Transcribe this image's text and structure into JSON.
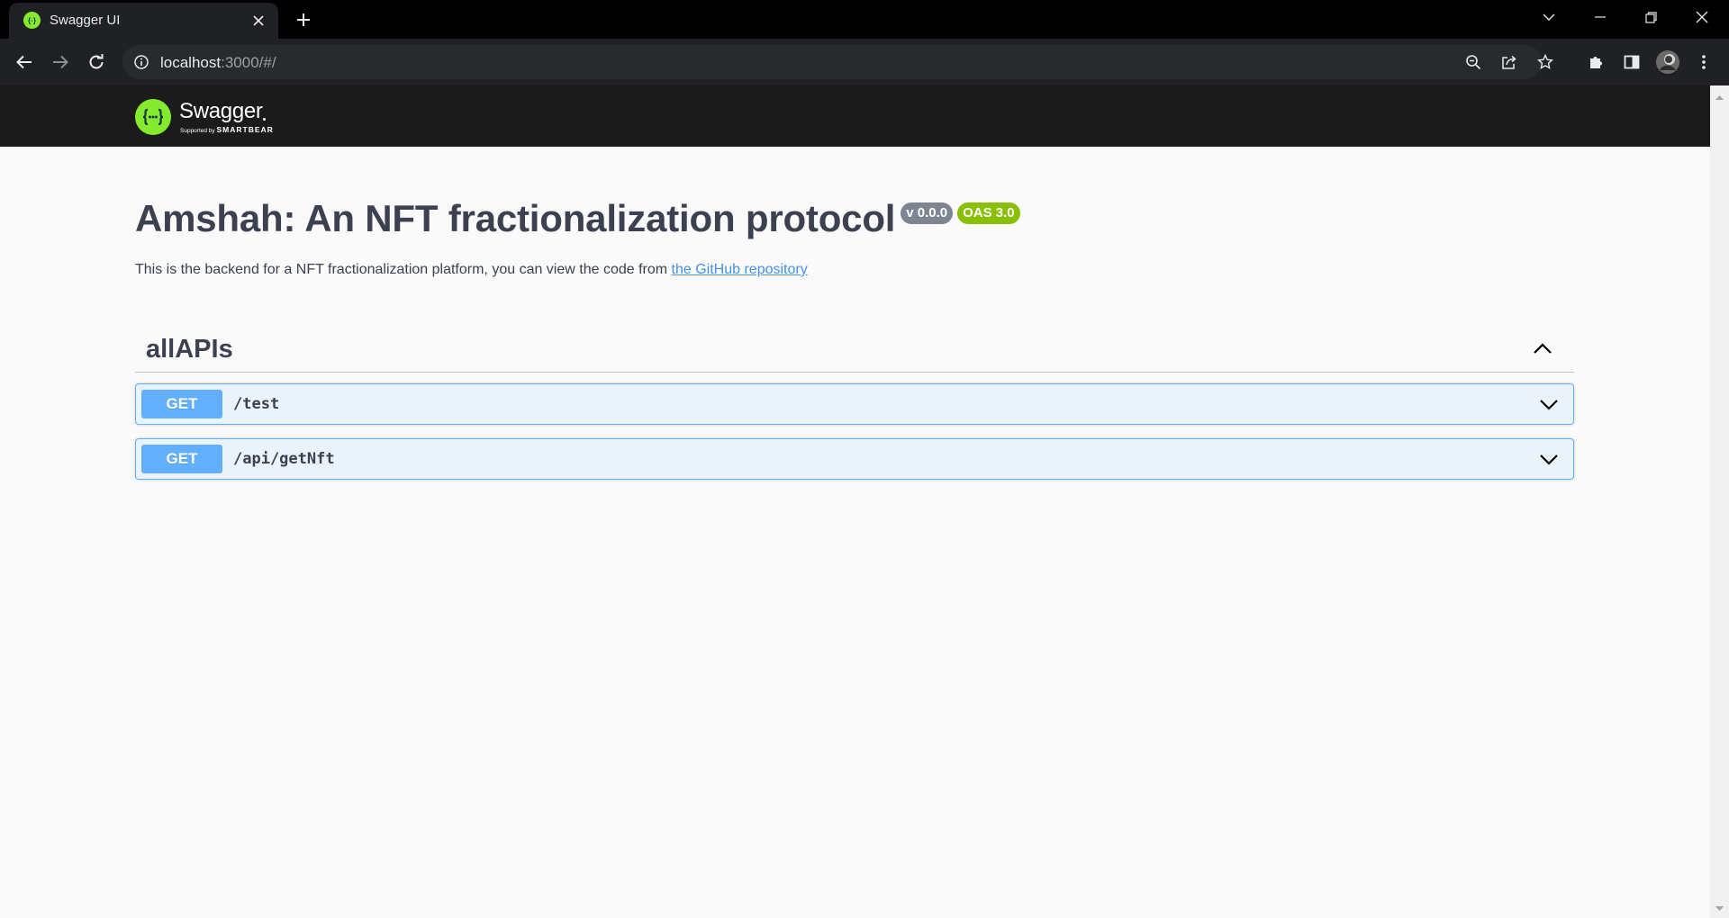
{
  "browser": {
    "tab": {
      "title": "Swagger UI",
      "favicon": "swagger-favicon"
    },
    "address_bar": {
      "host": "localhost",
      "path": ":3000/#/"
    },
    "icons": {
      "back": "arrow-left-icon",
      "forward": "arrow-right-icon",
      "reload": "reload-icon",
      "zoom": "zoom-icon",
      "share": "share-icon",
      "bookmark": "star-icon",
      "extensions": "puzzle-icon",
      "side_panel": "side-panel-icon",
      "menu": "kebab-menu-icon"
    }
  },
  "swagger": {
    "logo_word": "Swagger",
    "logo_sub_prefix": "Supported by",
    "logo_sub_brand": "SMARTBEAR"
  },
  "info": {
    "title": "Amshah: An NFT fractionalization protocol",
    "version_badge": "v 0.0.0",
    "oas_badge": "OAS 3.0",
    "description": "This is the backend for a NFT fractionalization platform, you can view the code from ",
    "link_text": "the GitHub repository"
  },
  "tags": [
    {
      "name": "allAPIs",
      "expanded": true,
      "operations": [
        {
          "method": "GET",
          "path": "/test"
        },
        {
          "method": "GET",
          "path": "/api/getNft"
        }
      ]
    }
  ],
  "colors": {
    "get_method": "#61affe",
    "oas_badge": "#89bf04",
    "version_badge": "#7d8492",
    "topbar": "#1b1b1b",
    "swagger_green": "#85ea2d",
    "link": "#4990e2"
  }
}
